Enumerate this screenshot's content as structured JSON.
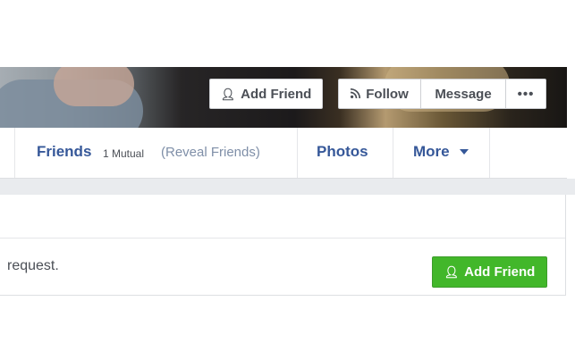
{
  "cover": {
    "add_friend_label": "Add Friend",
    "add_friend_icon": "add-person-icon",
    "follow_label": "Follow",
    "follow_icon": "rss-icon",
    "message_label": "Message",
    "more_label": "•••"
  },
  "nav": {
    "friends_label": "Friends",
    "mutual_label": "1 Mutual",
    "reveal_label": "(Reveal Friends)",
    "photos_label": "Photos",
    "more_label": "More"
  },
  "request": {
    "text": "request.",
    "button_label": "Add Friend",
    "button_icon": "add-person-icon",
    "button_color": "#42b72a"
  }
}
